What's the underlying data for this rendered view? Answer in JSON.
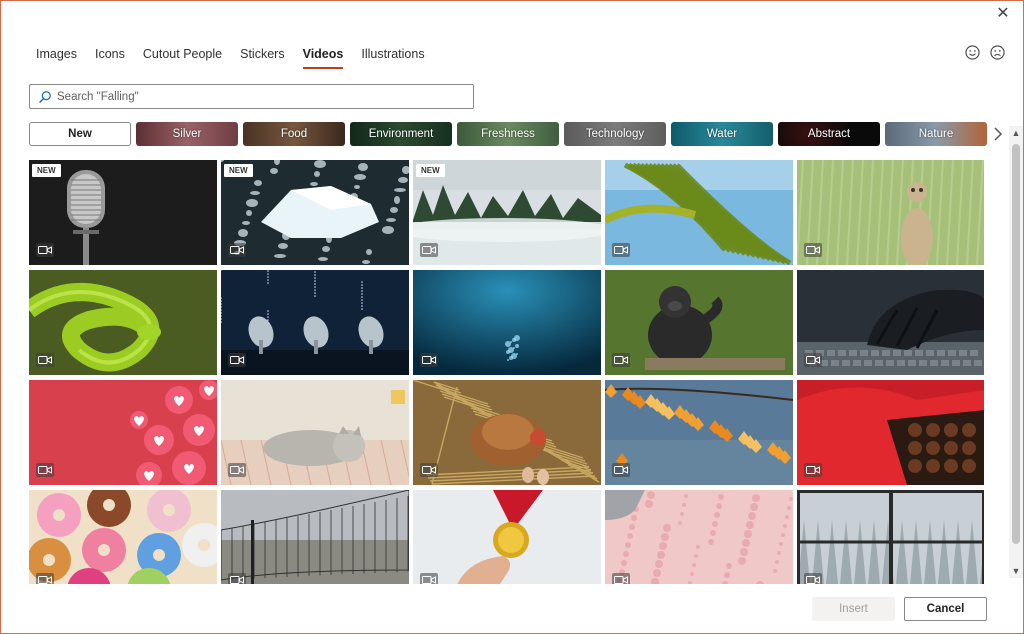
{
  "window": {
    "close_glyph": "✕"
  },
  "tabs": [
    {
      "label": "Images",
      "active": false
    },
    {
      "label": "Icons",
      "active": false
    },
    {
      "label": "Cutout People",
      "active": false
    },
    {
      "label": "Stickers",
      "active": false
    },
    {
      "label": "Videos",
      "active": true
    },
    {
      "label": "Illustrations",
      "active": false
    }
  ],
  "feedback": {
    "happy_icon": "smiley-face-icon",
    "sad_icon": "frown-face-icon"
  },
  "search": {
    "placeholder": "Search \"Falling\"",
    "value": ""
  },
  "categories": [
    {
      "label": "New",
      "color": "#ffffff"
    },
    {
      "label": "Silver",
      "color": "#7a4a4e"
    },
    {
      "label": "Food",
      "color": "#5a3e2e"
    },
    {
      "label": "Environment",
      "color": "#1f3a22"
    },
    {
      "label": "Freshness",
      "color": "#4a6a48"
    },
    {
      "label": "Technology",
      "color": "#6a6a6a"
    },
    {
      "label": "Water",
      "color": "#1a6a7a"
    },
    {
      "label": "Abstract",
      "color": "#101010"
    },
    {
      "label": "Nature",
      "color": "#6a7a8a"
    }
  ],
  "thumbnails": [
    {
      "name": "microphone",
      "badge": "NEW"
    },
    {
      "name": "iceberg",
      "badge": "NEW"
    },
    {
      "name": "misty-forest",
      "badge": "NEW"
    },
    {
      "name": "palm-leaves",
      "badge": ""
    },
    {
      "name": "meerkat",
      "badge": ""
    },
    {
      "name": "green-snake",
      "badge": ""
    },
    {
      "name": "satellite-dishes",
      "badge": ""
    },
    {
      "name": "underwater",
      "badge": ""
    },
    {
      "name": "gorilla",
      "badge": ""
    },
    {
      "name": "hand-typing",
      "badge": ""
    },
    {
      "name": "hearts",
      "badge": ""
    },
    {
      "name": "sleeping-kitten",
      "badge": ""
    },
    {
      "name": "hen-nest",
      "badge": ""
    },
    {
      "name": "autumn-leaves",
      "badge": ""
    },
    {
      "name": "chocolate-box",
      "badge": ""
    },
    {
      "name": "donuts",
      "badge": ""
    },
    {
      "name": "volleyball-net",
      "badge": ""
    },
    {
      "name": "gold-medal",
      "badge": ""
    },
    {
      "name": "ice-cream-scoop",
      "badge": ""
    },
    {
      "name": "snowy-window",
      "badge": ""
    }
  ],
  "footer": {
    "insert_label": "Insert",
    "cancel_label": "Cancel"
  }
}
